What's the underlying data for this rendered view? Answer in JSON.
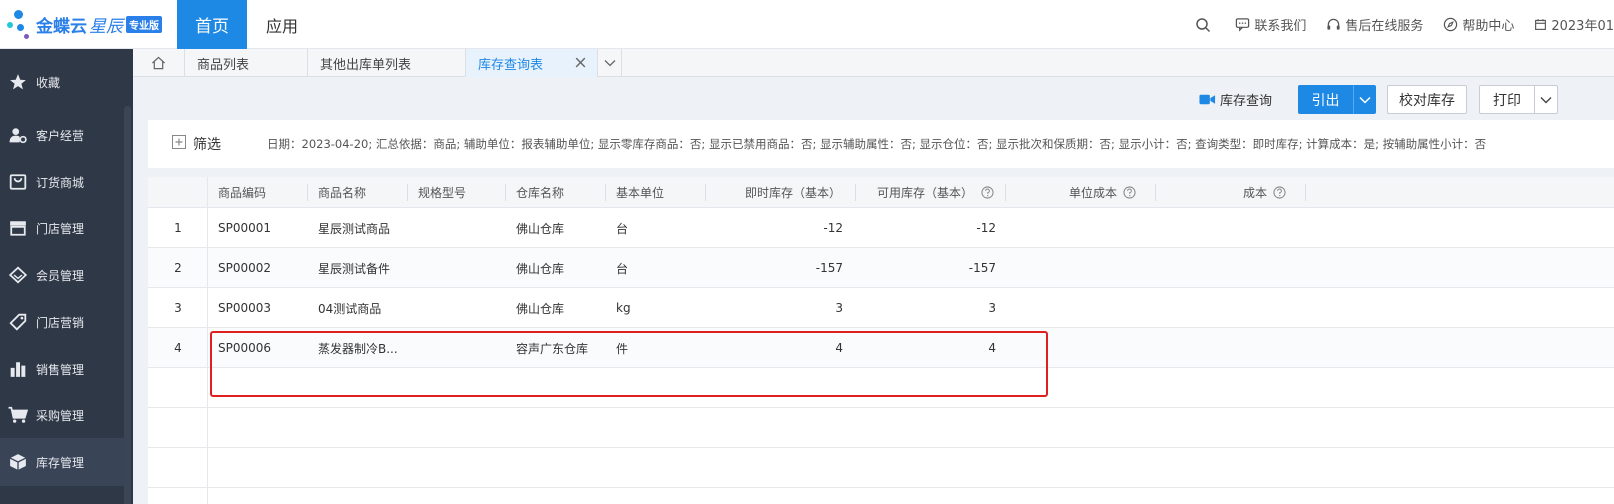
{
  "header": {
    "logo_brand": "金蝶云",
    "logo_product": "星辰",
    "logo_badge": "专业版",
    "nav_home": "首页",
    "nav_app": "应用",
    "contact": "联系我们",
    "service": "售后在线服务",
    "help": "帮助中心",
    "date": "2023年01"
  },
  "sidebar": {
    "items": [
      {
        "label": "收藏",
        "icon": "star-icon"
      },
      {
        "label": "客户经营",
        "icon": "user-gear-icon"
      },
      {
        "label": "订货商城",
        "icon": "bag-icon"
      },
      {
        "label": "门店管理",
        "icon": "store-icon"
      },
      {
        "label": "会员管理",
        "icon": "diamond-icon"
      },
      {
        "label": "门店营销",
        "icon": "tag-icon"
      },
      {
        "label": "销售管理",
        "icon": "bar-chart-icon"
      },
      {
        "label": "采购管理",
        "icon": "cart-icon"
      },
      {
        "label": "库存管理",
        "icon": "box-icon"
      }
    ]
  },
  "tabs": [
    {
      "label": "商品列表"
    },
    {
      "label": "其他出库单列表"
    },
    {
      "label": "库存查询表"
    }
  ],
  "toolbar": {
    "video_link": "库存查询",
    "export": "引出",
    "check": "校对库存",
    "print": "打印"
  },
  "filter": {
    "label": "筛选",
    "summary": "日期：2023-04-20; 汇总依据：商品; 辅助单位：报表辅助单位; 显示零库存商品：否; 显示已禁用商品：否; 显示辅助属性：否; 显示仓位：否; 显示批次和保质期：否; 显示小计：否; 查询类型：即时库存; 计算成本：是; 按辅助属性小计：否"
  },
  "table": {
    "columns": [
      "商品编码",
      "商品名称",
      "规格型号",
      "仓库名称",
      "基本单位",
      "即时库存（基本）",
      "可用库存（基本）",
      "单位成本",
      "成本"
    ],
    "rows": [
      {
        "no": "1",
        "code": "SP00001",
        "name": "星辰测试商品",
        "spec": "",
        "warehouse": "佛山仓库",
        "unit": "台",
        "stock": "-12",
        "available": "-12"
      },
      {
        "no": "2",
        "code": "SP00002",
        "name": "星辰测试备件",
        "spec": "",
        "warehouse": "佛山仓库",
        "unit": "台",
        "stock": "-157",
        "available": "-157"
      },
      {
        "no": "3",
        "code": "SP00003",
        "name": "04测试商品",
        "spec": "",
        "warehouse": "佛山仓库",
        "unit": "kg",
        "stock": "3",
        "available": "3"
      },
      {
        "no": "4",
        "code": "SP00006",
        "name": "蒸发器制冷B...",
        "spec": "",
        "warehouse": "容声广东仓库",
        "unit": "件",
        "stock": "4",
        "available": "4"
      }
    ]
  },
  "colors": {
    "primary": "#1e88e5",
    "sidebar": "#2f3847",
    "highlight": "#e02020"
  }
}
